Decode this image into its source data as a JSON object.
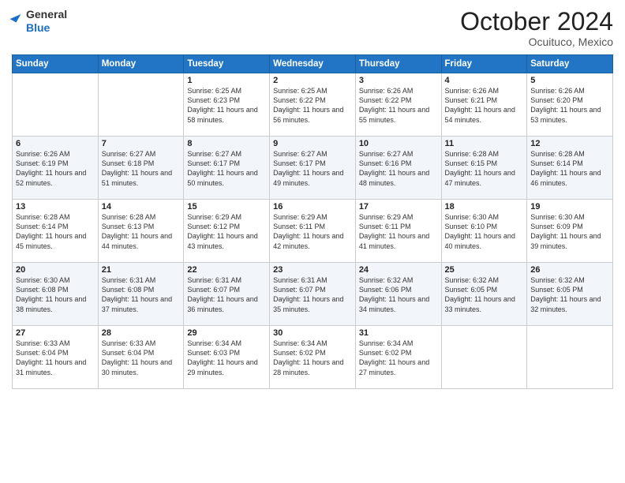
{
  "header": {
    "logo_line1": "General",
    "logo_line2": "Blue",
    "month": "October 2024",
    "location": "Ocuituco, Mexico"
  },
  "days_of_week": [
    "Sunday",
    "Monday",
    "Tuesday",
    "Wednesday",
    "Thursday",
    "Friday",
    "Saturday"
  ],
  "weeks": [
    [
      {
        "day": "",
        "info": ""
      },
      {
        "day": "",
        "info": ""
      },
      {
        "day": "1",
        "info": "Sunrise: 6:25 AM\nSunset: 6:23 PM\nDaylight: 11 hours and 58 minutes."
      },
      {
        "day": "2",
        "info": "Sunrise: 6:25 AM\nSunset: 6:22 PM\nDaylight: 11 hours and 56 minutes."
      },
      {
        "day": "3",
        "info": "Sunrise: 6:26 AM\nSunset: 6:22 PM\nDaylight: 11 hours and 55 minutes."
      },
      {
        "day": "4",
        "info": "Sunrise: 6:26 AM\nSunset: 6:21 PM\nDaylight: 11 hours and 54 minutes."
      },
      {
        "day": "5",
        "info": "Sunrise: 6:26 AM\nSunset: 6:20 PM\nDaylight: 11 hours and 53 minutes."
      }
    ],
    [
      {
        "day": "6",
        "info": "Sunrise: 6:26 AM\nSunset: 6:19 PM\nDaylight: 11 hours and 52 minutes."
      },
      {
        "day": "7",
        "info": "Sunrise: 6:27 AM\nSunset: 6:18 PM\nDaylight: 11 hours and 51 minutes."
      },
      {
        "day": "8",
        "info": "Sunrise: 6:27 AM\nSunset: 6:17 PM\nDaylight: 11 hours and 50 minutes."
      },
      {
        "day": "9",
        "info": "Sunrise: 6:27 AM\nSunset: 6:17 PM\nDaylight: 11 hours and 49 minutes."
      },
      {
        "day": "10",
        "info": "Sunrise: 6:27 AM\nSunset: 6:16 PM\nDaylight: 11 hours and 48 minutes."
      },
      {
        "day": "11",
        "info": "Sunrise: 6:28 AM\nSunset: 6:15 PM\nDaylight: 11 hours and 47 minutes."
      },
      {
        "day": "12",
        "info": "Sunrise: 6:28 AM\nSunset: 6:14 PM\nDaylight: 11 hours and 46 minutes."
      }
    ],
    [
      {
        "day": "13",
        "info": "Sunrise: 6:28 AM\nSunset: 6:14 PM\nDaylight: 11 hours and 45 minutes."
      },
      {
        "day": "14",
        "info": "Sunrise: 6:28 AM\nSunset: 6:13 PM\nDaylight: 11 hours and 44 minutes."
      },
      {
        "day": "15",
        "info": "Sunrise: 6:29 AM\nSunset: 6:12 PM\nDaylight: 11 hours and 43 minutes."
      },
      {
        "day": "16",
        "info": "Sunrise: 6:29 AM\nSunset: 6:11 PM\nDaylight: 11 hours and 42 minutes."
      },
      {
        "day": "17",
        "info": "Sunrise: 6:29 AM\nSunset: 6:11 PM\nDaylight: 11 hours and 41 minutes."
      },
      {
        "day": "18",
        "info": "Sunrise: 6:30 AM\nSunset: 6:10 PM\nDaylight: 11 hours and 40 minutes."
      },
      {
        "day": "19",
        "info": "Sunrise: 6:30 AM\nSunset: 6:09 PM\nDaylight: 11 hours and 39 minutes."
      }
    ],
    [
      {
        "day": "20",
        "info": "Sunrise: 6:30 AM\nSunset: 6:08 PM\nDaylight: 11 hours and 38 minutes."
      },
      {
        "day": "21",
        "info": "Sunrise: 6:31 AM\nSunset: 6:08 PM\nDaylight: 11 hours and 37 minutes."
      },
      {
        "day": "22",
        "info": "Sunrise: 6:31 AM\nSunset: 6:07 PM\nDaylight: 11 hours and 36 minutes."
      },
      {
        "day": "23",
        "info": "Sunrise: 6:31 AM\nSunset: 6:07 PM\nDaylight: 11 hours and 35 minutes."
      },
      {
        "day": "24",
        "info": "Sunrise: 6:32 AM\nSunset: 6:06 PM\nDaylight: 11 hours and 34 minutes."
      },
      {
        "day": "25",
        "info": "Sunrise: 6:32 AM\nSunset: 6:05 PM\nDaylight: 11 hours and 33 minutes."
      },
      {
        "day": "26",
        "info": "Sunrise: 6:32 AM\nSunset: 6:05 PM\nDaylight: 11 hours and 32 minutes."
      }
    ],
    [
      {
        "day": "27",
        "info": "Sunrise: 6:33 AM\nSunset: 6:04 PM\nDaylight: 11 hours and 31 minutes."
      },
      {
        "day": "28",
        "info": "Sunrise: 6:33 AM\nSunset: 6:04 PM\nDaylight: 11 hours and 30 minutes."
      },
      {
        "day": "29",
        "info": "Sunrise: 6:34 AM\nSunset: 6:03 PM\nDaylight: 11 hours and 29 minutes."
      },
      {
        "day": "30",
        "info": "Sunrise: 6:34 AM\nSunset: 6:02 PM\nDaylight: 11 hours and 28 minutes."
      },
      {
        "day": "31",
        "info": "Sunrise: 6:34 AM\nSunset: 6:02 PM\nDaylight: 11 hours and 27 minutes."
      },
      {
        "day": "",
        "info": ""
      },
      {
        "day": "",
        "info": ""
      }
    ]
  ]
}
